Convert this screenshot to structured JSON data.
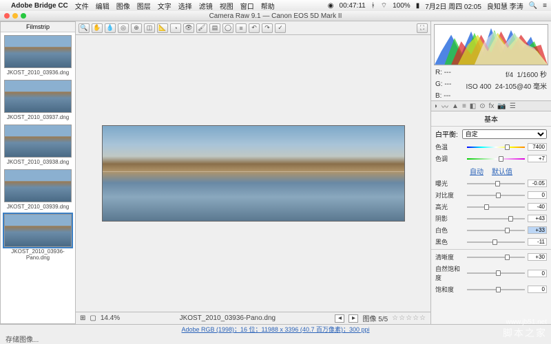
{
  "menubar": {
    "app": "Adobe Bridge CC",
    "items": [
      "文件",
      "编辑",
      "图像",
      "图层",
      "文字",
      "选择",
      "滤镜",
      "视图",
      "窗口",
      "帮助"
    ],
    "clock": "7月2日 周四 02:05",
    "user": "良知慧 李涛",
    "battery": "100%",
    "timer": "00:47:11"
  },
  "window": {
    "title": "Camera Raw 9.1 — Canon EOS 5D Mark II"
  },
  "filmstrip": {
    "title": "Filmstrip",
    "thumbs": [
      {
        "cap": "JKOST_2010_03936.dng"
      },
      {
        "cap": "JKOST_2010_03937.dng"
      },
      {
        "cap": "JKOST_2010_03938.dng"
      },
      {
        "cap": "JKOST_2010_03939.dng"
      },
      {
        "cap": "JKOST_2010_03936-Pano.dng"
      }
    ]
  },
  "status": {
    "zoom": "14.4%",
    "filename": "JKOST_2010_03936-Pano.dng",
    "count": "图像 5/5"
  },
  "meta": {
    "r": "R:",
    "g": "G:",
    "b": "B:",
    "rv": "---",
    "gv": "---",
    "bv": "---",
    "aperture": "f/4",
    "shutter": "1/1600 秒",
    "iso": "ISO 400",
    "lens": "24-105@40 毫米"
  },
  "panel": {
    "title": "基本",
    "wb_label": "白平衡:",
    "wb_value": "自定",
    "auto": "自动",
    "default": "默认值"
  },
  "sliders": [
    {
      "lbl": "色温",
      "val": "7400",
      "pos": 65,
      "track": "rainbow"
    },
    {
      "lbl": "色调",
      "val": "+7",
      "pos": 55,
      "track": "gm"
    },
    {
      "lbl": "曝光",
      "val": "-0.05",
      "pos": 49
    },
    {
      "lbl": "对比度",
      "val": "0",
      "pos": 50
    },
    {
      "lbl": "高光",
      "val": "-40",
      "pos": 30
    },
    {
      "lbl": "阴影",
      "val": "+43",
      "pos": 71
    },
    {
      "lbl": "白色",
      "val": "+33",
      "pos": 66,
      "hl": true
    },
    {
      "lbl": "黑色",
      "val": "-11",
      "pos": 44
    },
    {
      "lbl": "清晰度",
      "val": "+30",
      "pos": 65
    },
    {
      "lbl": "自然饱和度",
      "val": "0",
      "pos": 50
    },
    {
      "lbl": "饱和度",
      "val": "0",
      "pos": 50
    }
  ],
  "bottom": {
    "profile": "Adobe RGB (1998)；16 位；11988 x 3396 (40.7 百万像素)；300 ppi"
  },
  "save": {
    "label": "存储图像..."
  },
  "watermark": {
    "url": "www.jb51.net",
    "cn": "脚本之家"
  }
}
